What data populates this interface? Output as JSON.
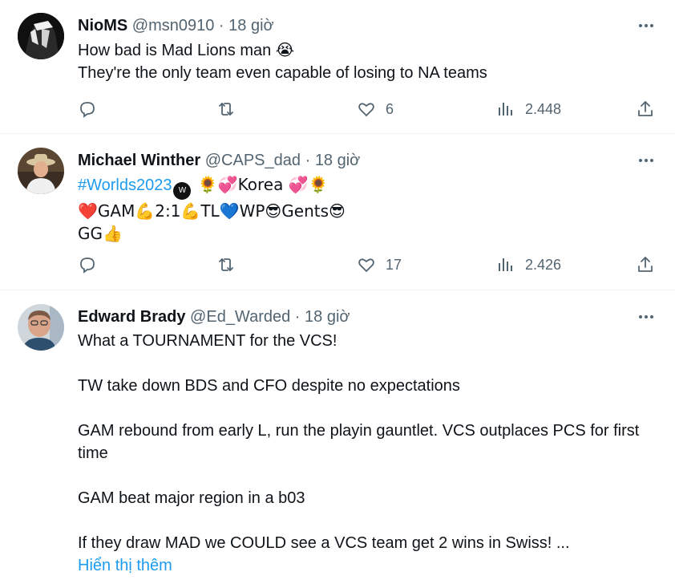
{
  "tweets": [
    {
      "name": "NioMS",
      "handle": "@msn0910",
      "dot": "·",
      "time": "18 giờ",
      "lines": [
        "How bad is Mad Lions man 😭",
        "They're the only team even capable of losing to NA teams"
      ],
      "likes": "6",
      "views": "2.448"
    },
    {
      "name": "Michael Winther",
      "handle": "@CAPS_dad",
      "dot": "·",
      "time": "18 giờ",
      "hashtag": "#Worlds2023",
      "line1_rest": " 🌻💞Korea 💞🌻",
      "line2": "❤️GAM💪2:1💪TL💙WP😎Gents😎",
      "line3": "GG👍",
      "likes": "17",
      "views": "2.426"
    },
    {
      "name": "Edward Brady",
      "handle": "@Ed_Warded",
      "dot": "·",
      "time": "18 giờ",
      "paragraphs": [
        "What a TOURNAMENT for the VCS!",
        "TW take down BDS and CFO despite no expectations",
        "GAM rebound from early L, run the playin gauntlet. VCS outplaces PCS for first time",
        "GAM beat major region in a b03",
        "If they draw MAD we COULD see a VCS team get 2 wins in Swiss! ..."
      ],
      "show_more": "Hiển thị thêm"
    }
  ],
  "icons": {
    "reply": "reply-icon",
    "retweet": "retweet-icon",
    "like": "heart-icon",
    "views": "views-icon",
    "share": "share-icon",
    "more": "more-icon"
  },
  "colors": {
    "text": "#0f1419",
    "muted": "#536471",
    "link": "#1d9bf0",
    "divider": "#eff3f4"
  }
}
